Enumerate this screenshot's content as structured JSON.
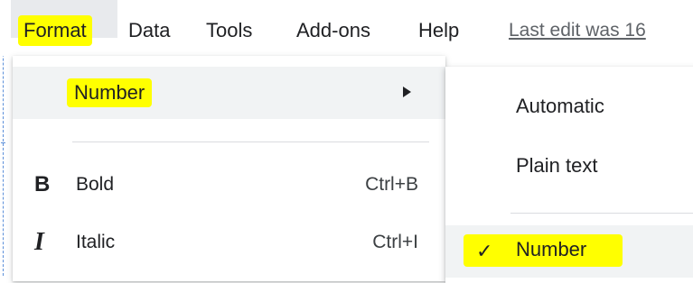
{
  "menubar": {
    "items": [
      "Format",
      "Data",
      "Tools",
      "Add-ons",
      "Help"
    ],
    "last_edit": "Last edit was 16"
  },
  "format_menu": {
    "number": {
      "label": "Number"
    },
    "bold": {
      "icon": "bold-icon",
      "glyph": "B",
      "label": "Bold",
      "shortcut": "Ctrl+B"
    },
    "italic": {
      "icon": "italic-icon",
      "glyph": "I",
      "label": "Italic",
      "shortcut": "Ctrl+I"
    }
  },
  "number_submenu": {
    "items": [
      "Automatic",
      "Plain text"
    ],
    "selected": {
      "label": "Number",
      "check": "✓"
    }
  },
  "colors": {
    "highlight": "#ffff00",
    "hover": "#f1f3f4",
    "divider": "#dadce0"
  }
}
